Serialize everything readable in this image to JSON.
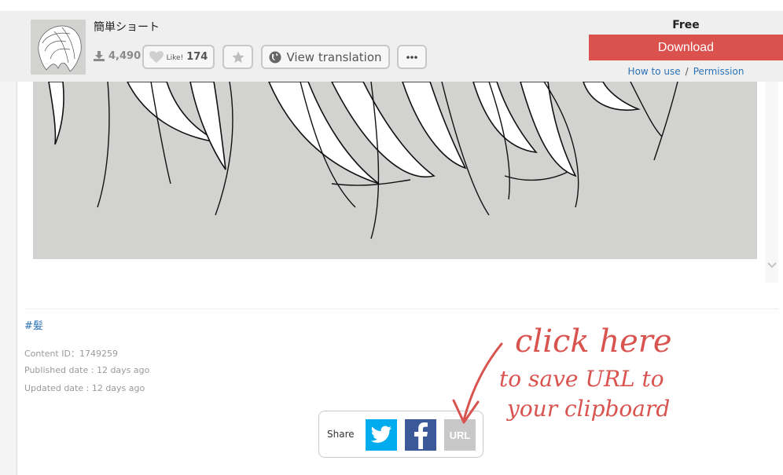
{
  "header": {
    "title": "簡単ショート",
    "download_count": "4,490",
    "like_label": "Like!",
    "like_count": "174",
    "translate_label": "View translation",
    "price": "Free",
    "download_label": "Download",
    "how_to_use": "How to use",
    "separator": "/",
    "permission": "Permission"
  },
  "details": {
    "tag": "#髪",
    "content_id": "Content ID：1749259",
    "published": "Published date : 12 days ago",
    "updated": "Updated date : 12 days ago"
  },
  "share": {
    "label": "Share",
    "url_label": "URL"
  },
  "annotation": {
    "line1": "click here",
    "line2": "to save URL to",
    "line3": "your clipboard",
    "color": "#d9534f"
  },
  "colors": {
    "download": "#db514d",
    "twitter": "#00aced",
    "facebook": "#3b5998",
    "link": "#2b73b7"
  }
}
